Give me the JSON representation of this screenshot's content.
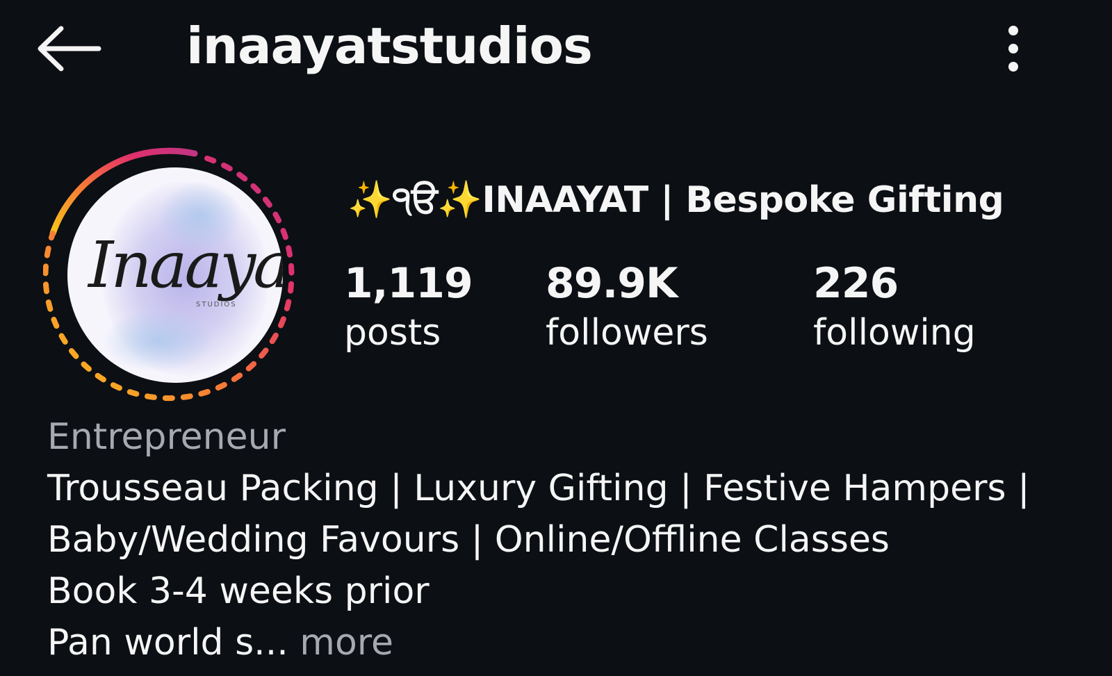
{
  "header": {
    "username": "inaayatstudios"
  },
  "profile": {
    "display_name": "✨੧ੳ✨INAAYAT | Bespoke Gifting",
    "avatar": {
      "logo_text": "Inaayat",
      "logo_subtext": "STUDIOS"
    },
    "stats": [
      {
        "value": "1,119",
        "label": "posts"
      },
      {
        "value": "89.9K",
        "label": "followers"
      },
      {
        "value": "226",
        "label": "following"
      }
    ],
    "bio": {
      "category": "Entrepreneur",
      "lines": [
        "Trousseau Packing | Luxury Gifting | Festive Hampers |",
        "Baby/Wedding Favours | Online/Offline Classes",
        "Book 3-4 weeks prior"
      ],
      "truncated_line": "Pan world s...",
      "more_label": "more"
    }
  },
  "icons": {
    "back": "arrow-left-icon",
    "menu": "vertical-dots-icon",
    "story_ring": "story-ring"
  },
  "colors": {
    "background": "#0c0f14",
    "text": "#f5f5f5",
    "muted_text": "#a8a8b0",
    "ring_gradient": [
      "#f9c51a",
      "#f77737",
      "#e1306c",
      "#c13584"
    ]
  }
}
